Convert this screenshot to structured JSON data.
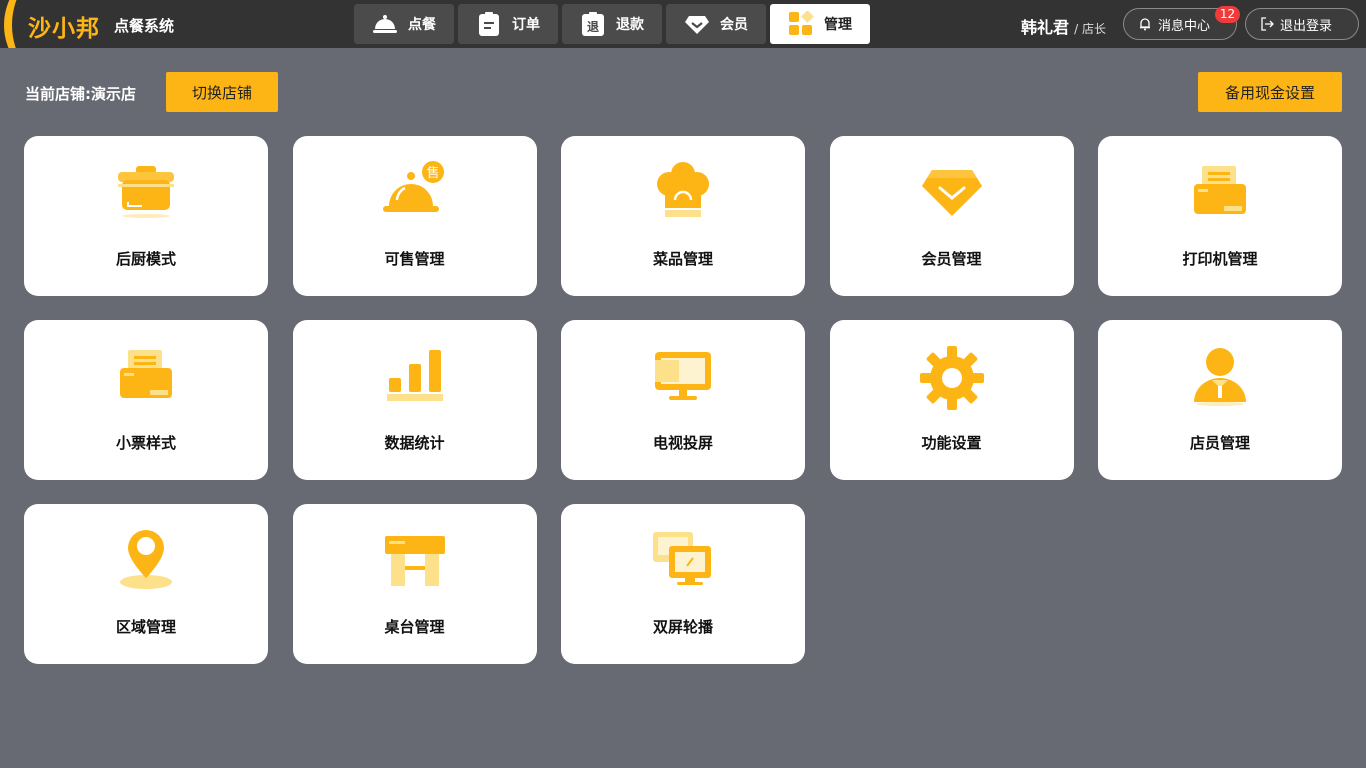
{
  "brand": {
    "name": "沙小邦",
    "subtitle": "点餐系统",
    "accent": "#fdb515"
  },
  "nav": {
    "tabs": [
      {
        "label": "点餐",
        "icon": "cloche-icon"
      },
      {
        "label": "订单",
        "icon": "clipboard-icon"
      },
      {
        "label": "退款",
        "icon": "refund-icon",
        "glyph": "退"
      },
      {
        "label": "会员",
        "icon": "diamond-icon"
      },
      {
        "label": "管理",
        "icon": "grid-icon",
        "active": true
      }
    ]
  },
  "user": {
    "name": "韩礼君",
    "role": "/ 店长"
  },
  "messages": {
    "label": "消息中心",
    "count": "12"
  },
  "logout": {
    "label": "退出登录"
  },
  "store": {
    "label": "当前店铺:演示店",
    "switch_label": "切换店铺",
    "cash_label": "备用现金设置"
  },
  "modules": [
    {
      "label": "后厨模式",
      "icon": "pot-icon"
    },
    {
      "label": "可售管理",
      "icon": "cloche-sale-icon",
      "badge": "售"
    },
    {
      "label": "菜品管理",
      "icon": "chef-hat-icon"
    },
    {
      "label": "会员管理",
      "icon": "diamond-icon"
    },
    {
      "label": "打印机管理",
      "icon": "printer-icon"
    },
    {
      "label": "小票样式",
      "icon": "receipt-icon"
    },
    {
      "label": "数据统计",
      "icon": "bar-chart-icon"
    },
    {
      "label": "电视投屏",
      "icon": "monitor-icon"
    },
    {
      "label": "功能设置",
      "icon": "gear-icon"
    },
    {
      "label": "店员管理",
      "icon": "staff-icon"
    },
    {
      "label": "区域管理",
      "icon": "location-pin-icon"
    },
    {
      "label": "桌台管理",
      "icon": "table-icon"
    },
    {
      "label": "双屏轮播",
      "icon": "dual-screen-icon"
    }
  ]
}
